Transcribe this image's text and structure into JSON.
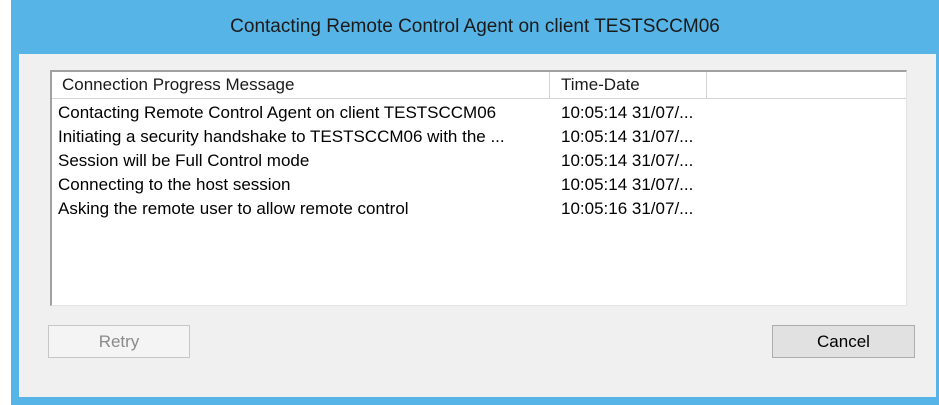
{
  "window": {
    "title": "Contacting Remote Control Agent on client TESTSCCM06"
  },
  "list": {
    "columns": [
      {
        "label": "Connection Progress Message"
      },
      {
        "label": "Time-Date"
      },
      {
        "label": ""
      }
    ],
    "rows": [
      {
        "message": "Contacting Remote Control Agent on client TESTSCCM06",
        "time": "10:05:14 31/07/..."
      },
      {
        "message": "Initiating a security handshake to TESTSCCM06 with the ...",
        "time": "10:05:14 31/07/..."
      },
      {
        "message": "Session will be Full Control mode",
        "time": "10:05:14 31/07/..."
      },
      {
        "message": "Connecting to the host session",
        "time": "10:05:14 31/07/..."
      },
      {
        "message": "Asking the remote user to allow remote control",
        "time": "10:05:16 31/07/..."
      }
    ]
  },
  "buttons": {
    "retry_label": "Retry",
    "retry_enabled": false,
    "cancel_label": "Cancel"
  },
  "colors": {
    "window_frame": "#56b4e6",
    "client_background": "#f0f0f0"
  }
}
